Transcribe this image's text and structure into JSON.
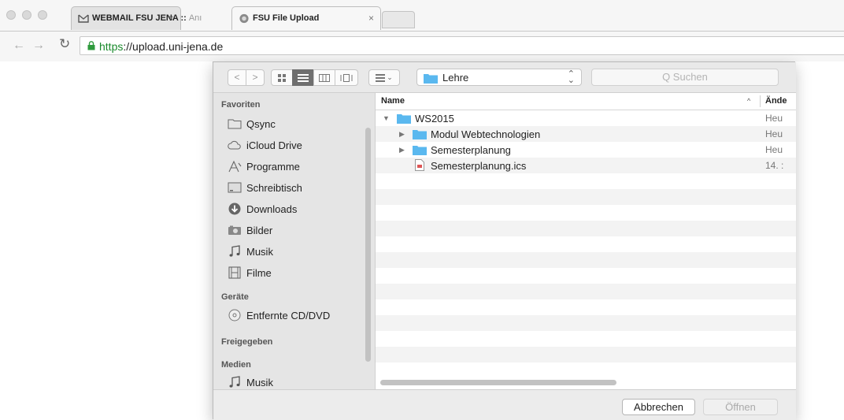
{
  "browser": {
    "tabs": [
      {
        "title": "WEBMAIL FSU JENA :: ",
        "title_dim": "Anı",
        "active": false
      },
      {
        "title": "FSU File Upload",
        "title_dim": "",
        "active": true
      }
    ],
    "url_scheme": "https",
    "url_rest": "://upload.uni-jena.de",
    "secure_color": "#1a8a2c"
  },
  "dialog": {
    "location": "Lehre",
    "search_placeholder": "Q Suchen",
    "sidebar": {
      "sections": [
        {
          "header": "Favoriten",
          "items": [
            {
              "label": "Qsync",
              "icon": "folder-icon"
            },
            {
              "label": "iCloud Drive",
              "icon": "cloud-icon"
            },
            {
              "label": "Programme",
              "icon": "applications-icon"
            },
            {
              "label": "Schreibtisch",
              "icon": "desktop-icon"
            },
            {
              "label": "Downloads",
              "icon": "download-icon"
            },
            {
              "label": "Bilder",
              "icon": "camera-icon"
            },
            {
              "label": "Musik",
              "icon": "music-note-icon"
            },
            {
              "label": "Filme",
              "icon": "film-icon"
            }
          ]
        },
        {
          "header": "Geräte",
          "items": [
            {
              "label": "Entfernte CD/DVD",
              "icon": "disc-icon"
            }
          ]
        },
        {
          "header": "Freigegeben",
          "items": []
        },
        {
          "header": "Medien",
          "items": [
            {
              "label": "Musik",
              "icon": "music-note-icon"
            }
          ]
        }
      ]
    },
    "columns": {
      "name": "Name",
      "date": "Ände"
    },
    "files": [
      {
        "name": "WS2015",
        "type": "folder",
        "expanded": true,
        "level": 0,
        "date": "Heu"
      },
      {
        "name": "Modul Webtechnologien",
        "type": "folder",
        "expanded": false,
        "level": 1,
        "date": "Heu"
      },
      {
        "name": "Semesterplanung",
        "type": "folder",
        "expanded": false,
        "level": 1,
        "date": "Heu"
      },
      {
        "name": "Semesterplanung.ics",
        "type": "file",
        "expanded": false,
        "level": 1,
        "date": "14. :"
      }
    ],
    "buttons": {
      "cancel": "Abbrechen",
      "open": "Öffnen"
    },
    "colors": {
      "folder": "#5ab8ef",
      "selected_view": "#6f6f6f"
    }
  }
}
